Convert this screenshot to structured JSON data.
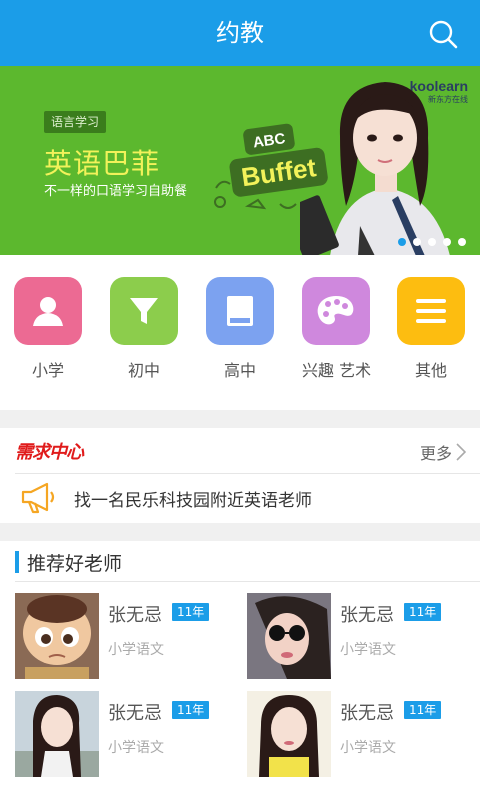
{
  "header": {
    "title": "约教",
    "search_icon": "search-icon"
  },
  "banner": {
    "tag": "语言学习",
    "headline": "英语巴菲",
    "subtitle": "不一样的口语学习自助餐",
    "brand_name": "koolearn",
    "brand_sub": "新东方在线",
    "badge_small": "ABC",
    "badge_big": "Buffet",
    "slide_count": 5,
    "active_slide": 0
  },
  "categories": [
    {
      "label": "小学",
      "icon": "person-icon",
      "color": "#ec6a93"
    },
    {
      "label": "初中",
      "icon": "funnel-icon",
      "color": "#8ccd4c"
    },
    {
      "label": "高中",
      "icon": "book-icon",
      "color": "#7ca2f0"
    },
    {
      "label": "兴趣  艺术",
      "icon": "palette-icon",
      "color": "#cf88dd"
    },
    {
      "label": "其他",
      "icon": "menu-icon",
      "color": "#fdbd10"
    }
  ],
  "demand": {
    "title": "需求中心",
    "more": "更多",
    "item": "找一名民乐科技园附近英语老师"
  },
  "recommend": {
    "title": "推荐好老师",
    "teachers": [
      {
        "name": "张无忌",
        "years": "11年",
        "subject": "小学语文"
      },
      {
        "name": "张无忌",
        "years": "11年",
        "subject": "小学语文"
      },
      {
        "name": "张无忌",
        "years": "11年",
        "subject": "小学语文"
      },
      {
        "name": "张无忌",
        "years": "11年",
        "subject": "小学语文"
      }
    ]
  },
  "colors": {
    "primary": "#1b9de8",
    "banner": "#5cb82e",
    "demand_title": "#e01b1b"
  }
}
